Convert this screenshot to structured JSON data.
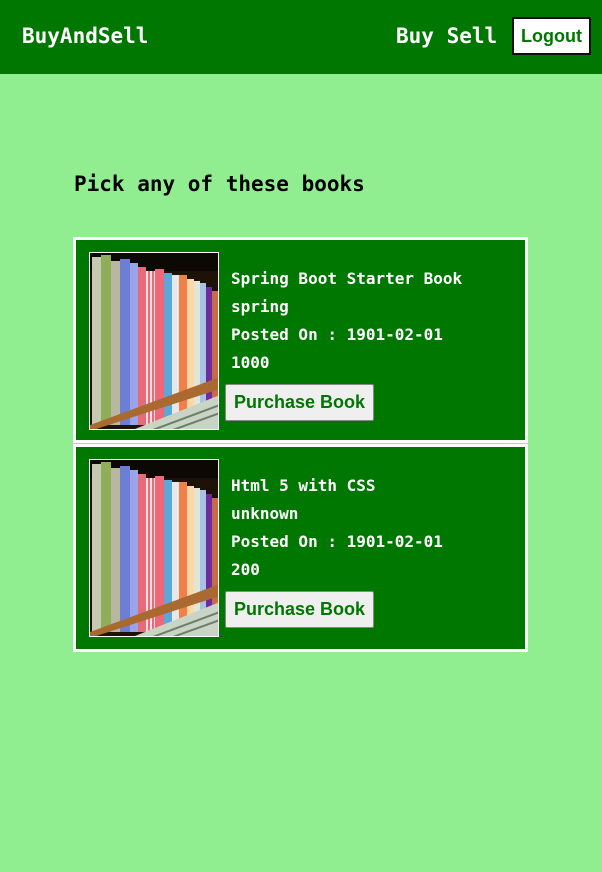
{
  "navbar": {
    "brand": "BuyAndSell",
    "links": [
      "Buy",
      "Sell"
    ],
    "logout_label": "Logout"
  },
  "main": {
    "heading": "Pick any of these books"
  },
  "books": [
    {
      "title": "Spring Boot Starter Book",
      "category": "spring",
      "posted": "Posted On : 1901-02-01",
      "price": "1000",
      "button_label": "Purchase Book"
    },
    {
      "title": "Html 5 with CSS",
      "category": "unknown",
      "posted": "Posted On : 1901-02-01",
      "price": "200",
      "button_label": "Purchase Book"
    }
  ],
  "colors": {
    "navbar": "#007700",
    "page_background": "#90EE90",
    "card_background": "#007700",
    "button_text": "#007700"
  }
}
